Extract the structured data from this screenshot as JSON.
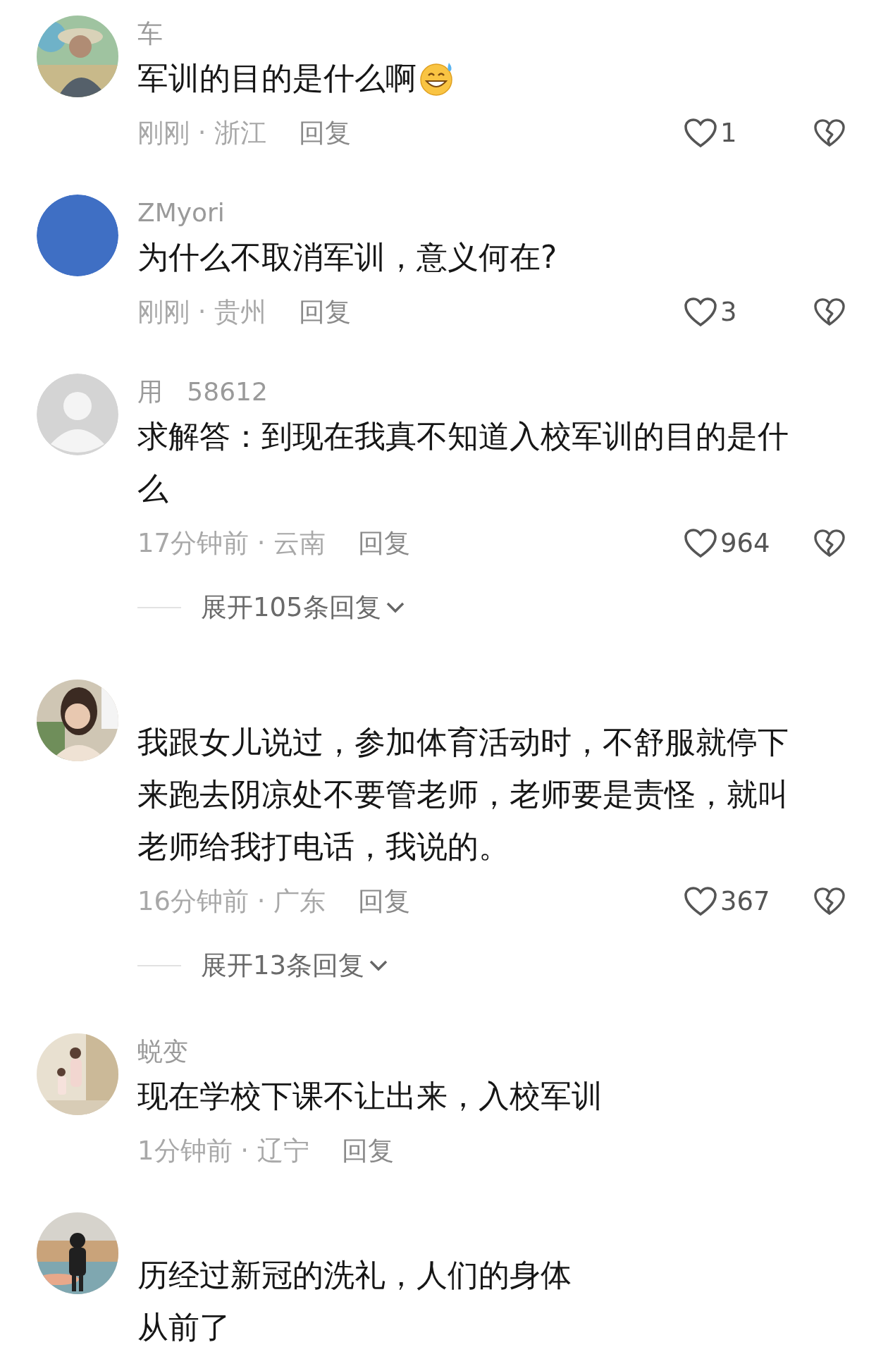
{
  "comments": [
    {
      "avatar": {
        "kind": "picture"
      },
      "username": "车",
      "lines": [
        "军训的目的是什么啊"
      ],
      "emoji": true,
      "meta": "刚刚 · 浙江",
      "reply": "回复",
      "likes": "1"
    },
    {
      "avatar": {
        "kind": "plain"
      },
      "username": "ZMyori",
      "lines": [
        "为什么不取消军训，意义何在?"
      ],
      "meta": "刚刚 · 贵州",
      "reply": "回复",
      "likes": "3"
    },
    {
      "avatar": {
        "kind": "default"
      },
      "username": "用   58612",
      "lines": [
        "求解答：到现在我真不知道入校军训的目的是什",
        "么"
      ],
      "meta": "17分钟前 · 云南",
      "reply": "回复",
      "likes": "964",
      "expand": "展开105条回复"
    },
    {
      "avatar": {
        "kind": "picture"
      },
      "lines": [
        "我跟女儿说过，参加体育活动时，不舒服就停下",
        "来跑去阴凉处不要管老师，老师要是责怪，就叫",
        "老师给我打电话，我说的。"
      ],
      "meta": "16分钟前 · 广东",
      "reply": "回复",
      "likes": "367",
      "expand": "展开13条回复"
    },
    {
      "avatar": {
        "kind": "picture"
      },
      "username": "蜕变",
      "lines": [
        "现在学校下课不让出来，入校军训"
      ],
      "meta": "1分钟前 · 辽宁",
      "reply": "回复"
    },
    {
      "avatar": {
        "kind": "picture"
      },
      "lines": [
        "历经过新冠的洗礼，人们的身体",
        "从前了"
      ]
    }
  ]
}
